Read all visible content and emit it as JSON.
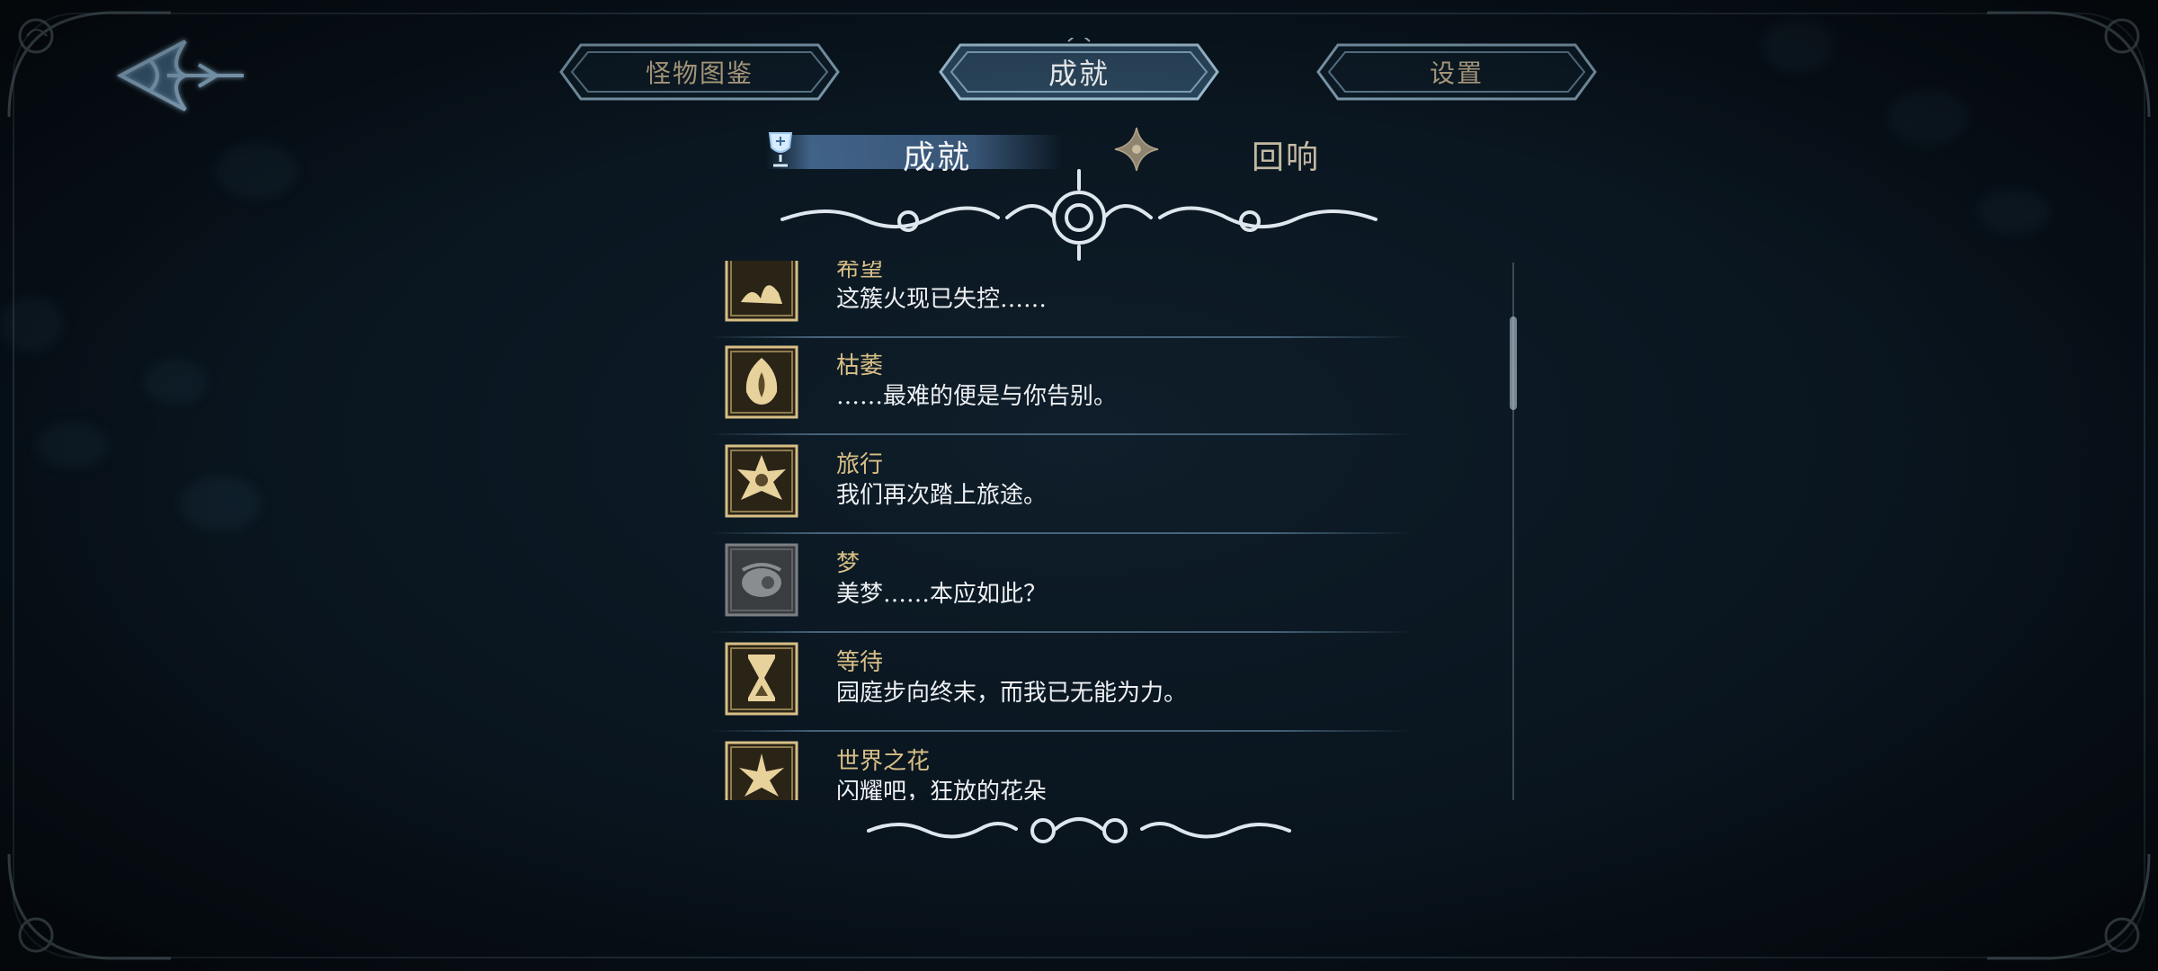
{
  "colors": {
    "accent": "#6fa8d8",
    "gold": "#d8bf86",
    "text": "#eef0f2",
    "muted_tab": "#b9a98a"
  },
  "top_tabs": [
    {
      "label": "怪物图鉴",
      "active": false
    },
    {
      "label": "成就",
      "active": true
    },
    {
      "label": "设置",
      "active": false
    }
  ],
  "sub_tabs": [
    {
      "label": "成就",
      "icon": "trophy-icon",
      "active": true
    },
    {
      "label": "回响",
      "icon": "four-point-star-icon",
      "active": false
    }
  ],
  "achievements": [
    {
      "title": "希望",
      "desc": "这簇火现已失控……",
      "icon": "hope-icon",
      "unlocked": true
    },
    {
      "title": "枯萎",
      "desc": "……最难的便是与你告别。",
      "icon": "wither-icon",
      "unlocked": true
    },
    {
      "title": "旅行",
      "desc": "我们再次踏上旅途。",
      "icon": "journey-icon",
      "unlocked": true
    },
    {
      "title": "梦",
      "desc": "美梦……本应如此？",
      "icon": "dream-icon",
      "unlocked": false
    },
    {
      "title": "等待",
      "desc": "园庭步向终末，而我已无能为力。",
      "icon": "hourglass-icon",
      "unlocked": true
    },
    {
      "title": "世界之花",
      "desc": "闪耀吧，狂放的花朵",
      "icon": "world-flower-icon",
      "unlocked": true
    }
  ]
}
